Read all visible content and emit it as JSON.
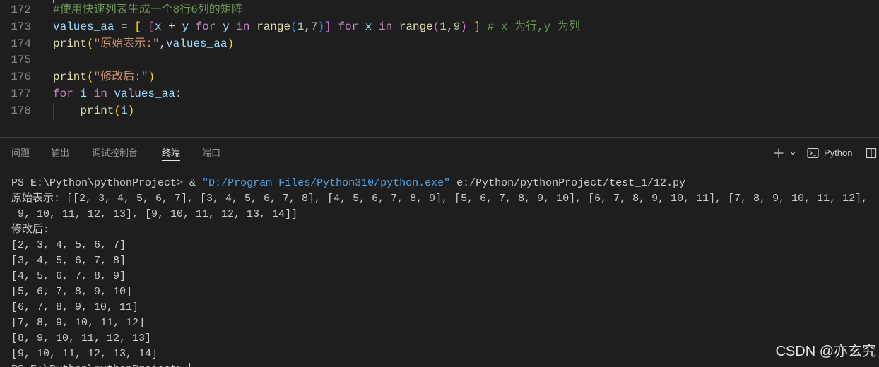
{
  "editor": {
    "lines": [
      {
        "number": "172",
        "tokens": [
          "#使用快速列表生成一个8行6列的矩阵"
        ]
      },
      {
        "number": "173",
        "tokens": [
          "values_aa",
          " = ",
          "[ ",
          "[",
          "x",
          " + ",
          "y ",
          "for ",
          "y ",
          "in ",
          "range",
          "(",
          "1",
          ",",
          "7",
          ")",
          "] ",
          "for ",
          "x ",
          "in ",
          "range",
          "(",
          "1",
          ",",
          "9",
          ") ",
          "] ",
          "# x 为行,y 为列"
        ]
      },
      {
        "number": "174",
        "tokens": [
          "print",
          "(",
          "\"原始表示:\"",
          ",",
          "values_aa",
          ")"
        ]
      },
      {
        "number": "175",
        "tokens": []
      },
      {
        "number": "176",
        "tokens": [
          "print",
          "(",
          "\"修改后:\"",
          ")"
        ]
      },
      {
        "number": "177",
        "tokens": [
          "for ",
          "i ",
          "in ",
          "values_aa",
          ":"
        ]
      },
      {
        "number": "178",
        "tokens": [
          "print",
          "(",
          "i",
          ")"
        ]
      }
    ]
  },
  "panel": {
    "tabs": [
      {
        "label": "问题",
        "active": false
      },
      {
        "label": "输出",
        "active": false
      },
      {
        "label": "调试控制台",
        "active": false
      },
      {
        "label": "终端",
        "active": true
      },
      {
        "label": "端口",
        "active": false
      }
    ],
    "terminal_profile_label": "Python",
    "icons": {
      "new_terminal": "plus-icon",
      "launch_profile": "chevron-down-icon",
      "terminal_type": "terminal-powershell-icon",
      "split_terminal": "split-terminal-icon"
    }
  },
  "terminal": {
    "command": {
      "prompt": "PS E:\\Python\\pythonProject>",
      "operator": " & ",
      "executable": "\"D:/Program Files/Python310/python.exe\"",
      "script": " e:/Python/pythonProject/test_1/12.py"
    },
    "output": [
      "原始表示: [[2, 3, 4, 5, 6, 7], [3, 4, 5, 6, 7, 8], [4, 5, 6, 7, 8, 9], [5, 6, 7, 8, 9, 10], [6, 7, 8, 9, 10, 11], [7, 8, 9, 10, 11, 12],",
      " 9, 10, 11, 12, 13], [9, 10, 11, 12, 13, 14]]",
      "修改后:",
      "[2, 3, 4, 5, 6, 7]",
      "[3, 4, 5, 6, 7, 8]",
      "[4, 5, 6, 7, 8, 9]",
      "[5, 6, 7, 8, 9, 10]",
      "[6, 7, 8, 9, 10, 11]",
      "[7, 8, 9, 10, 11, 12]",
      "[8, 9, 10, 11, 12, 13]",
      "[9, 10, 11, 12, 13, 14]"
    ],
    "prompt": "PS E:\\Python\\pythonProject> "
  },
  "watermark": "CSDN @亦玄究",
  "theme": {
    "editor_background": "#1e1e1e",
    "panel_background": "#1e1e1e",
    "line_number": "#858585",
    "comment": "#6a9955",
    "keyword": "#c586c0",
    "function": "#dcdcaa",
    "variable": "#9cdcfe",
    "string": "#ce9178",
    "number": "#b5cea8",
    "bracket_level_1": "#ffd700",
    "bracket_level_2": "#da70d6",
    "bracket_level_3": "#179fff",
    "active_tab_border": "#e7e7e7",
    "terminal_foreground": "#cccccc",
    "terminal_string": "#4da3ea"
  }
}
